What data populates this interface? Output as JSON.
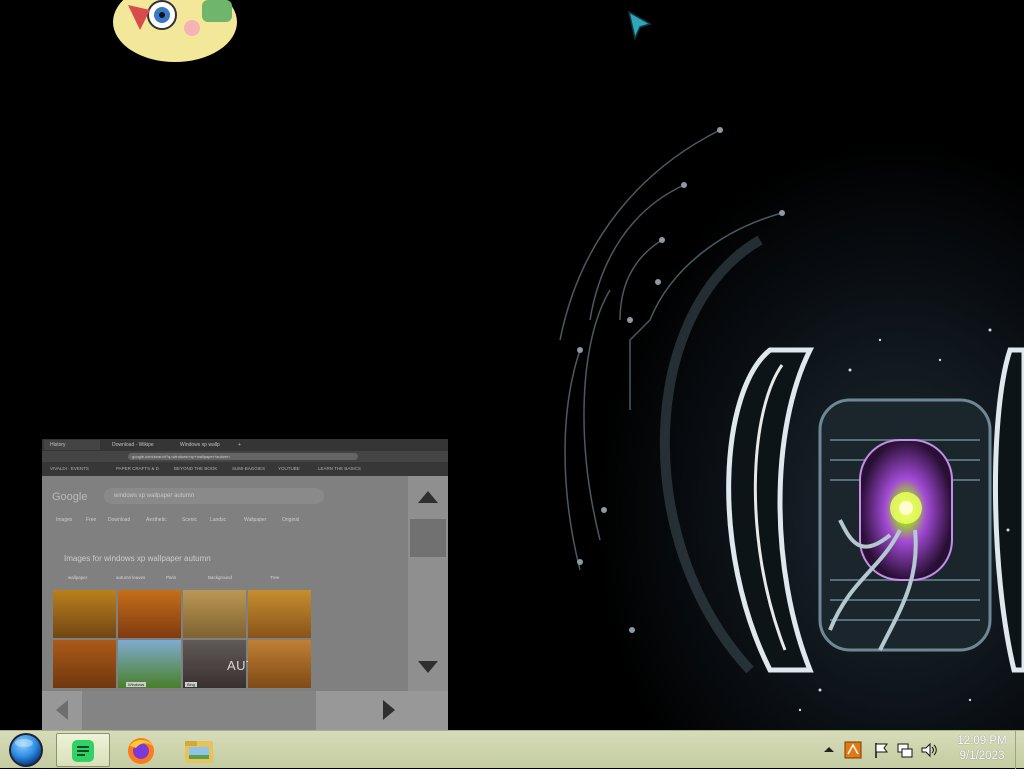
{
  "preview_window": {
    "tabs": [
      "History",
      "Download · Wikipe",
      "Windows xp wallp",
      "+"
    ],
    "url": "google.com/search?q=windows+xp+wallpaper+autumn",
    "bookmarks": [
      "VIVALDI · EVENTS",
      "PAPER CRAFTS & D",
      "BEYOND THE BOOK",
      "SUMI-BAGGIES",
      "YOUTUBE",
      "LEARN THE BASICS"
    ],
    "logo": "Google",
    "search_query": "windows xp wallpaper autumn",
    "filters": [
      "Images",
      "Free",
      "Download",
      "Aesthetic",
      "Scenic",
      "Landsc",
      "Wallpaper",
      "Original"
    ],
    "results_heading": "Images for windows xp wallpaper autumn",
    "chips": [
      "wallpaper",
      "autumn leaves",
      "Paris",
      "Background",
      "Tree"
    ],
    "thumbnail_text": "AUTUMN",
    "thumb_badge_1": "Windows",
    "thumb_badge_2": "Bing"
  },
  "taskbar": {
    "apps": [
      {
        "name": "Notes"
      },
      {
        "name": "Firefox"
      },
      {
        "name": "File Explorer"
      }
    ],
    "clock_time": "12:09 PM",
    "clock_date": "9/1/2023"
  },
  "colors": {
    "taskbar": "#d6dcb8",
    "start_orb": "#2f8fe4",
    "notes_app": "#2fd266",
    "wallpaper_glow": "#a34bd6"
  }
}
